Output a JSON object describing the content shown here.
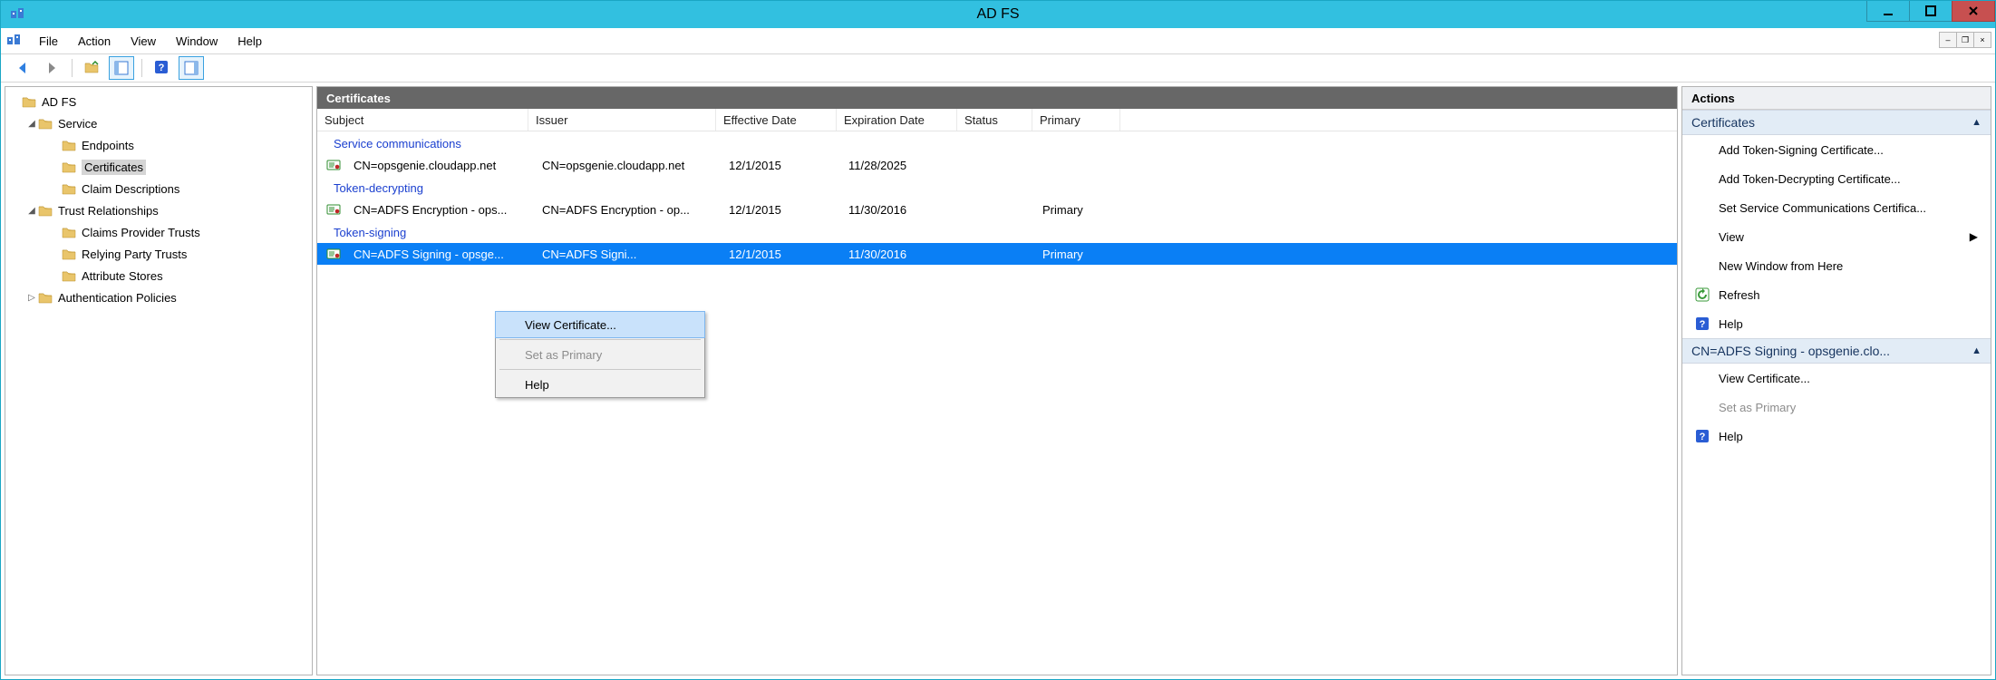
{
  "app": {
    "title": "AD FS"
  },
  "menus": {
    "file": "File",
    "action": "Action",
    "view": "View",
    "window": "Window",
    "help": "Help"
  },
  "tree": {
    "root": "AD FS",
    "service": "Service",
    "endpoints": "Endpoints",
    "certificates": "Certificates",
    "claim_descriptions": "Claim Descriptions",
    "trust_relationships": "Trust Relationships",
    "claims_provider_trusts": "Claims Provider Trusts",
    "relying_party_trusts": "Relying Party Trusts",
    "attribute_stores": "Attribute Stores",
    "authentication_policies": "Authentication Policies"
  },
  "list": {
    "header": "Certificates",
    "columns": {
      "subject": "Subject",
      "issuer": "Issuer",
      "effective": "Effective Date",
      "expiration": "Expiration Date",
      "status": "Status",
      "primary": "Primary"
    },
    "groups": {
      "service_comm": "Service communications",
      "token_decrypting": "Token-decrypting",
      "token_signing": "Token-signing"
    },
    "rows": {
      "sc": {
        "subject": "CN=opsgenie.cloudapp.net",
        "issuer": "CN=opsgenie.cloudapp.net",
        "effective": "12/1/2015",
        "expiration": "11/28/2025",
        "status": "",
        "primary": ""
      },
      "td": {
        "subject": "CN=ADFS Encryption - ops...",
        "issuer": "CN=ADFS Encryption - op...",
        "effective": "12/1/2015",
        "expiration": "11/30/2016",
        "status": "",
        "primary": "Primary"
      },
      "ts": {
        "subject": "CN=ADFS Signing - opsge...",
        "issuer": "CN=ADFS Signi...",
        "effective": "12/1/2015",
        "expiration": "11/30/2016",
        "status": "",
        "primary": "Primary"
      }
    }
  },
  "context_menu": {
    "view_certificate": "View Certificate...",
    "set_as_primary": "Set as Primary",
    "help": "Help"
  },
  "actions": {
    "header": "Actions",
    "group_certificates": "Certificates",
    "add_token_signing": "Add Token-Signing Certificate...",
    "add_token_decrypting": "Add Token-Decrypting Certificate...",
    "set_service_comm": "Set Service Communications Certifica...",
    "view": "View",
    "new_window": "New Window from Here",
    "refresh": "Refresh",
    "help": "Help",
    "group_selected": "CN=ADFS Signing - opsgenie.clo...",
    "view_certificate": "View Certificate...",
    "set_as_primary": "Set as Primary",
    "help2": "Help"
  }
}
